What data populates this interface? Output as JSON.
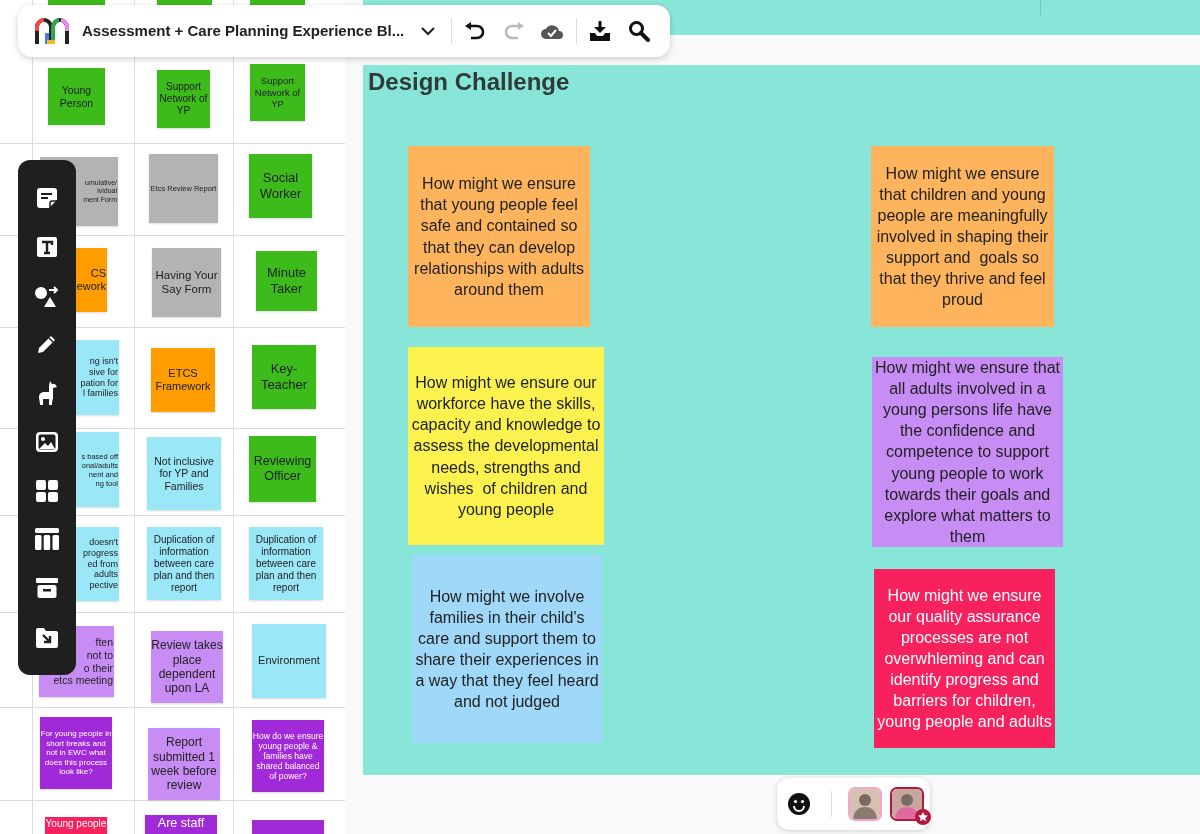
{
  "top_bar": {
    "title": "Assessment + Care Planning Experience Bl...",
    "actions": [
      {
        "kind": "undo",
        "disabled": false
      },
      {
        "kind": "redo",
        "disabled": true
      },
      {
        "kind": "saved",
        "disabled": false
      },
      {
        "kind": "download",
        "disabled": false
      },
      {
        "kind": "search",
        "disabled": false
      }
    ]
  },
  "left_board": {
    "stickies": [
      {
        "color": "#3dbb1b"
      },
      {
        "color": "#3dbb1b"
      },
      {
        "color": "#3dbb1b"
      },
      {
        "text": "Young Person",
        "color": "#3dbb1b"
      },
      {
        "text": "Support Network of YP",
        "color": "#3dbb1b"
      },
      {
        "text": "Support Network of YP",
        "color": "#3dbb1b"
      },
      {
        "text": "umulative/\nividual\nment Form",
        "color": "#b3b3b3"
      },
      {
        "text": "Etcs Review Report",
        "color": "#b3b3b3"
      },
      {
        "text": "Social Worker",
        "color": "#3dbb1b"
      },
      {
        "text": "CS\nework",
        "color": "#ff9d00"
      },
      {
        "text": "Having Your Say Form",
        "color": "#b3b3b3"
      },
      {
        "text": "Minute Taker",
        "color": "#3dbb1b"
      },
      {
        "text": "ng isn't\nsive for\npation for\nl families",
        "color": "#9ae7f8"
      },
      {
        "text": "ETCS Framework",
        "color": "#ff9d00"
      },
      {
        "text": "Key-Teacher",
        "color": "#3dbb1b"
      },
      {
        "text": "s based off\nonal/adults\nnent and\nng tool",
        "color": "#9ae7f8"
      },
      {
        "text": "Not inclusive for YP and Families",
        "color": "#9ae7f8"
      },
      {
        "text": "Reviewing Officer",
        "color": "#3dbb1b"
      },
      {
        "text": "doesn't\nprogress\ned from\nadults\npective",
        "color": "#9ae7f8"
      },
      {
        "text": "Duplication of information between care plan and then report",
        "color": "#9ae7f8"
      },
      {
        "text": "Duplication of information between care plan and then report",
        "color": "#9ae7f8"
      },
      {
        "text": "ften\nnot to\no their\netcs meeting",
        "color": "#c88cf5"
      },
      {
        "text": "Review takes place dependent upon LA",
        "color": "#c88cf5"
      },
      {
        "text": "Environment",
        "color": "#9ae7f8"
      },
      {
        "text": "For young people in short breaks and not in EWC what does this process look like?",
        "color": "#a12ad8"
      },
      {
        "text": "Report submitted 1 week before review",
        "color": "#c88cf5"
      },
      {
        "text": "How do we ensure young people & families have shared balanced of power?",
        "color": "#a12ad8"
      },
      {
        "text": "Young people",
        "color": "#f7215e"
      },
      {
        "text": "Are staff",
        "color": "#a12ad8"
      },
      {
        "color": "#a12ad8"
      }
    ]
  },
  "design_challenge": {
    "title": "Design Challenge",
    "stickies": [
      {
        "text": "How might we ensure that young people feel safe and contained so that they can develop relationships with adults around them",
        "color": "#fdb45d"
      },
      {
        "text": "How might we ensure our workforce have the skills, capacity and knowledge to assess the developmental needs, strengths and wishes  of children and young people",
        "color": "#fcf24f"
      },
      {
        "text": "How might we involve families in their child's care and support them to share their experiences in a way that they feel heard and not judged",
        "color": "#9fd8f8"
      },
      {
        "text": "How might we ensure that children and young people are meaningfully involved in shaping their support and  goals so that they thrive and feel proud",
        "color": "#fdb45d"
      },
      {
        "text": "How might we ensure that all adults involved in a young persons life have the confidence and competence to support young people to work towards their goals and explore what matters to them",
        "color": "#c88cf5"
      },
      {
        "text": "How might we ensure our quality assurance processes are not overwhleming and can identify progress and barriers for children, young people and adults",
        "color": "#f7215e"
      }
    ]
  },
  "collaborators": [
    {
      "facilitator": false
    },
    {
      "facilitator": true
    }
  ]
}
